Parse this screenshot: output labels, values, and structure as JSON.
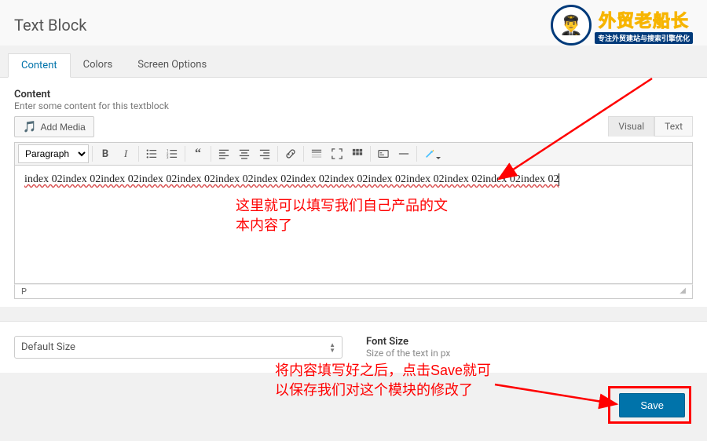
{
  "header": {
    "title": "Text Block",
    "logo_main": "外贸老船长",
    "logo_sub": "专注外贸建站与搜索引擎优化"
  },
  "tabs": {
    "content": "Content",
    "colors": "Colors",
    "screen_options": "Screen Options"
  },
  "content": {
    "label": "Content",
    "desc": "Enter some content for this textblock",
    "add_media": "Add Media",
    "mode_visual": "Visual",
    "mode_text": "Text",
    "format_select": "Paragraph",
    "editor_text": "index 02index 02index 02index 02index 02index 02index 02index 02index 02index 02index 02index 02index 02index 02",
    "status_path": "P"
  },
  "size_row": {
    "select_value": "Default Size",
    "label": "Font Size",
    "desc": "Size of the text in px"
  },
  "save": {
    "label": "Save"
  },
  "annotations": {
    "a1": "这里就可以填写我们自己产品的文本内容了",
    "a2": "将内容填写好之后，点击Save就可以保存我们对这个模块的修改了"
  }
}
